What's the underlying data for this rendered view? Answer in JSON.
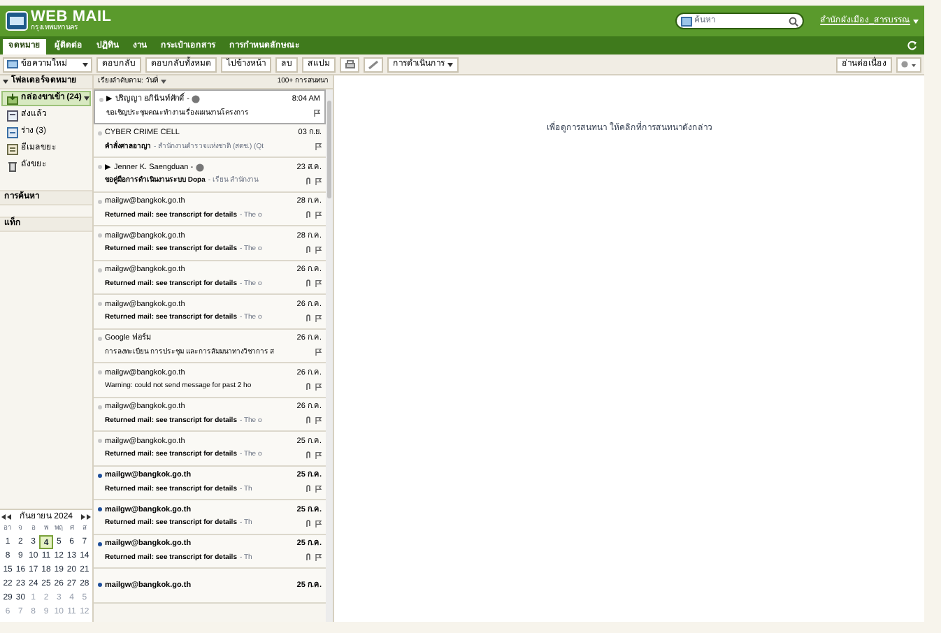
{
  "header": {
    "logo_title": "WEB MAIL",
    "logo_subtitle": "กรุงเทพมหานคร",
    "search": {
      "placeholder": "ค้นหา"
    },
    "user": "สำนักผังเมือง_สารบรรณ"
  },
  "tabs": [
    {
      "label": "จดหมาย",
      "selected": true
    },
    {
      "label": "ผู้ติดต่อ",
      "selected": false
    },
    {
      "label": "ปฏิทิน",
      "selected": false
    },
    {
      "label": "งาน",
      "selected": false
    },
    {
      "label": "กระเป๋าเอกสาร",
      "selected": false
    },
    {
      "label": "การกำหนดลักษณะ",
      "selected": false
    }
  ],
  "toolbar": {
    "new_message": "ข้อความใหม่",
    "buttons": [
      "ตอบกลับ",
      "ตอบกลับทั้งหมด",
      "ไปข้างหน้า",
      "ลบ",
      "สแปม"
    ],
    "actions": "การดำเนินการ",
    "reading": "อ่านต่อเนื่อง"
  },
  "sidebar": {
    "heading": "โฟลเดอร์จดหมาย",
    "folders": [
      {
        "label": "กล่องขาเข้า (24)",
        "selected": true,
        "kind": "inbox"
      },
      {
        "label": "ส่งแล้ว",
        "selected": false,
        "kind": "sent"
      },
      {
        "label": "ร่าง (3)",
        "selected": false,
        "kind": "drafts"
      },
      {
        "label": "อีเมลขยะ",
        "selected": false,
        "kind": "junk"
      },
      {
        "label": "ถังขยะ",
        "selected": false,
        "kind": "trash"
      }
    ],
    "sections": [
      "การค้นหา",
      "แท็ก"
    ]
  },
  "calendar": {
    "title": "กันยายน 2024",
    "weekdays": [
      "อา",
      "จ",
      "อ",
      "พ",
      "พฤ",
      "ศ",
      "ส"
    ],
    "days": [
      [
        {
          "d": "1",
          "other": false,
          "today": false
        },
        {
          "d": "2",
          "other": false,
          "today": false
        },
        {
          "d": "3",
          "other": false,
          "today": false
        },
        {
          "d": "4",
          "other": false,
          "today": true
        },
        {
          "d": "5",
          "other": false,
          "today": false
        },
        {
          "d": "6",
          "other": false,
          "today": false
        },
        {
          "d": "7",
          "other": false,
          "today": false
        }
      ],
      [
        {
          "d": "8",
          "other": false,
          "today": false
        },
        {
          "d": "9",
          "other": false,
          "today": false
        },
        {
          "d": "10",
          "other": false,
          "today": false
        },
        {
          "d": "11",
          "other": false,
          "today": false
        },
        {
          "d": "12",
          "other": false,
          "today": false
        },
        {
          "d": "13",
          "other": false,
          "today": false
        },
        {
          "d": "14",
          "other": false,
          "today": false
        }
      ],
      [
        {
          "d": "15",
          "other": false,
          "today": false
        },
        {
          "d": "16",
          "other": false,
          "today": false
        },
        {
          "d": "17",
          "other": false,
          "today": false
        },
        {
          "d": "18",
          "other": false,
          "today": false
        },
        {
          "d": "19",
          "other": false,
          "today": false
        },
        {
          "d": "20",
          "other": false,
          "today": false
        },
        {
          "d": "21",
          "other": false,
          "today": false
        }
      ],
      [
        {
          "d": "22",
          "other": false,
          "today": false
        },
        {
          "d": "23",
          "other": false,
          "today": false
        },
        {
          "d": "24",
          "other": false,
          "today": false
        },
        {
          "d": "25",
          "other": false,
          "today": false
        },
        {
          "d": "26",
          "other": false,
          "today": false
        },
        {
          "d": "27",
          "other": false,
          "today": false
        },
        {
          "d": "28",
          "other": false,
          "today": false
        }
      ],
      [
        {
          "d": "29",
          "other": false,
          "today": false
        },
        {
          "d": "30",
          "other": false,
          "today": false
        },
        {
          "d": "1",
          "other": true,
          "today": false
        },
        {
          "d": "2",
          "other": true,
          "today": false
        },
        {
          "d": "3",
          "other": true,
          "today": false
        },
        {
          "d": "4",
          "other": true,
          "today": false
        },
        {
          "d": "5",
          "other": true,
          "today": false
        }
      ],
      [
        {
          "d": "6",
          "other": true,
          "today": false
        },
        {
          "d": "7",
          "other": true,
          "today": false
        },
        {
          "d": "8",
          "other": true,
          "today": false
        },
        {
          "d": "9",
          "other": true,
          "today": false
        },
        {
          "d": "10",
          "other": true,
          "today": false
        },
        {
          "d": "11",
          "other": true,
          "today": false
        },
        {
          "d": "12",
          "other": true,
          "today": false
        }
      ]
    ]
  },
  "message_list": {
    "sort": "เรียงลำดับตาม: วันที่",
    "count": "100+ การสนทนา",
    "messages": [
      {
        "sender": "▶ ปริญญา อภินันท์ศักดิ์ -",
        "time": "8:04 AM",
        "subject": "ขอเชิญประชุมคณะทำงานเรื่องแผนงานโครงการ",
        "thread": true,
        "unread": false,
        "selected": true,
        "attachment": false
      },
      {
        "sender": "CYBER CRIME CELL",
        "time": "03 ก.ย.",
        "subject": "คำสั่งศาลอาญา",
        "preview": " - สำนักงานตำรวจแห่งชาติ (สตช.) (Qt",
        "thread": false,
        "unread": false,
        "selected": false,
        "attachment": false
      },
      {
        "sender": "▶ Jenner K. Saengduan -",
        "time": "23 ส.ค.",
        "subject": "ขอคู่มือการดำเนินงานระบบ Dopa",
        "preview": " - เรียน สำนักงาน",
        "thread": true,
        "unread": false,
        "selected": false,
        "attachment": true
      },
      {
        "sender": "mailgw@bangkok.go.th",
        "time": "28 ก.ค.",
        "subject": "Returned mail: see transcript for details",
        "preview": " - The o",
        "thread": false,
        "unread": false,
        "selected": false,
        "attachment": true
      },
      {
        "sender": "mailgw@bangkok.go.th",
        "time": "28 ก.ค.",
        "subject": "Returned mail: see transcript for details",
        "preview": " - The o",
        "thread": false,
        "unread": false,
        "selected": false,
        "attachment": true
      },
      {
        "sender": "mailgw@bangkok.go.th",
        "time": "26 ก.ค.",
        "subject": "Returned mail: see transcript for details",
        "preview": " - The o",
        "thread": false,
        "unread": false,
        "selected": false,
        "attachment": true
      },
      {
        "sender": "mailgw@bangkok.go.th",
        "time": "26 ก.ค.",
        "subject": "Returned mail: see transcript for details",
        "preview": " - The o",
        "thread": false,
        "unread": false,
        "selected": false,
        "attachment": true
      },
      {
        "sender": "Google ฟอร์ม",
        "time": "26 ก.ค.",
        "subject": "การลงทะเบียน การประชุม และการสัมมนาทางวิชาการ ส",
        "thread": false,
        "unread": false,
        "selected": false,
        "attachment": false
      },
      {
        "sender": "mailgw@bangkok.go.th",
        "time": "26 ก.ค.",
        "subject": "Warning: could not send message for past 2 ho",
        "thread": false,
        "unread": false,
        "selected": false,
        "attachment": true
      },
      {
        "sender": "mailgw@bangkok.go.th",
        "time": "26 ก.ค.",
        "subject": "Returned mail: see transcript for details",
        "preview": " - The o",
        "thread": false,
        "unread": false,
        "selected": false,
        "attachment": true
      },
      {
        "sender": "mailgw@bangkok.go.th",
        "time": "25 ก.ค.",
        "subject": "Returned mail: see transcript for details",
        "preview": " - The o",
        "thread": false,
        "unread": false,
        "selected": false,
        "attachment": true
      },
      {
        "sender": "mailgw@bangkok.go.th",
        "time": "25 ก.ค.",
        "subject": "Returned mail: see transcript for details",
        "preview": " - Th",
        "thread": false,
        "unread": true,
        "selected": false,
        "attachment": true
      },
      {
        "sender": "mailgw@bangkok.go.th",
        "time": "25 ก.ค.",
        "subject": "Returned mail: see transcript for details",
        "preview": " - Th",
        "thread": false,
        "unread": true,
        "selected": false,
        "attachment": true
      },
      {
        "sender": "mailgw@bangkok.go.th",
        "time": "25 ก.ค.",
        "subject": "Returned mail: see transcript for details",
        "preview": " - Th",
        "thread": false,
        "unread": true,
        "selected": false,
        "attachment": true
      },
      {
        "sender": "mailgw@bangkok.go.th",
        "time": "25 ก.ค.",
        "thread": false,
        "unread": true,
        "selected": false,
        "attachment": false
      }
    ]
  },
  "reading_pane": {
    "hint": "เพื่อดูการสนทนา ให้คลิกที่การสนทนาดังกล่าว"
  }
}
